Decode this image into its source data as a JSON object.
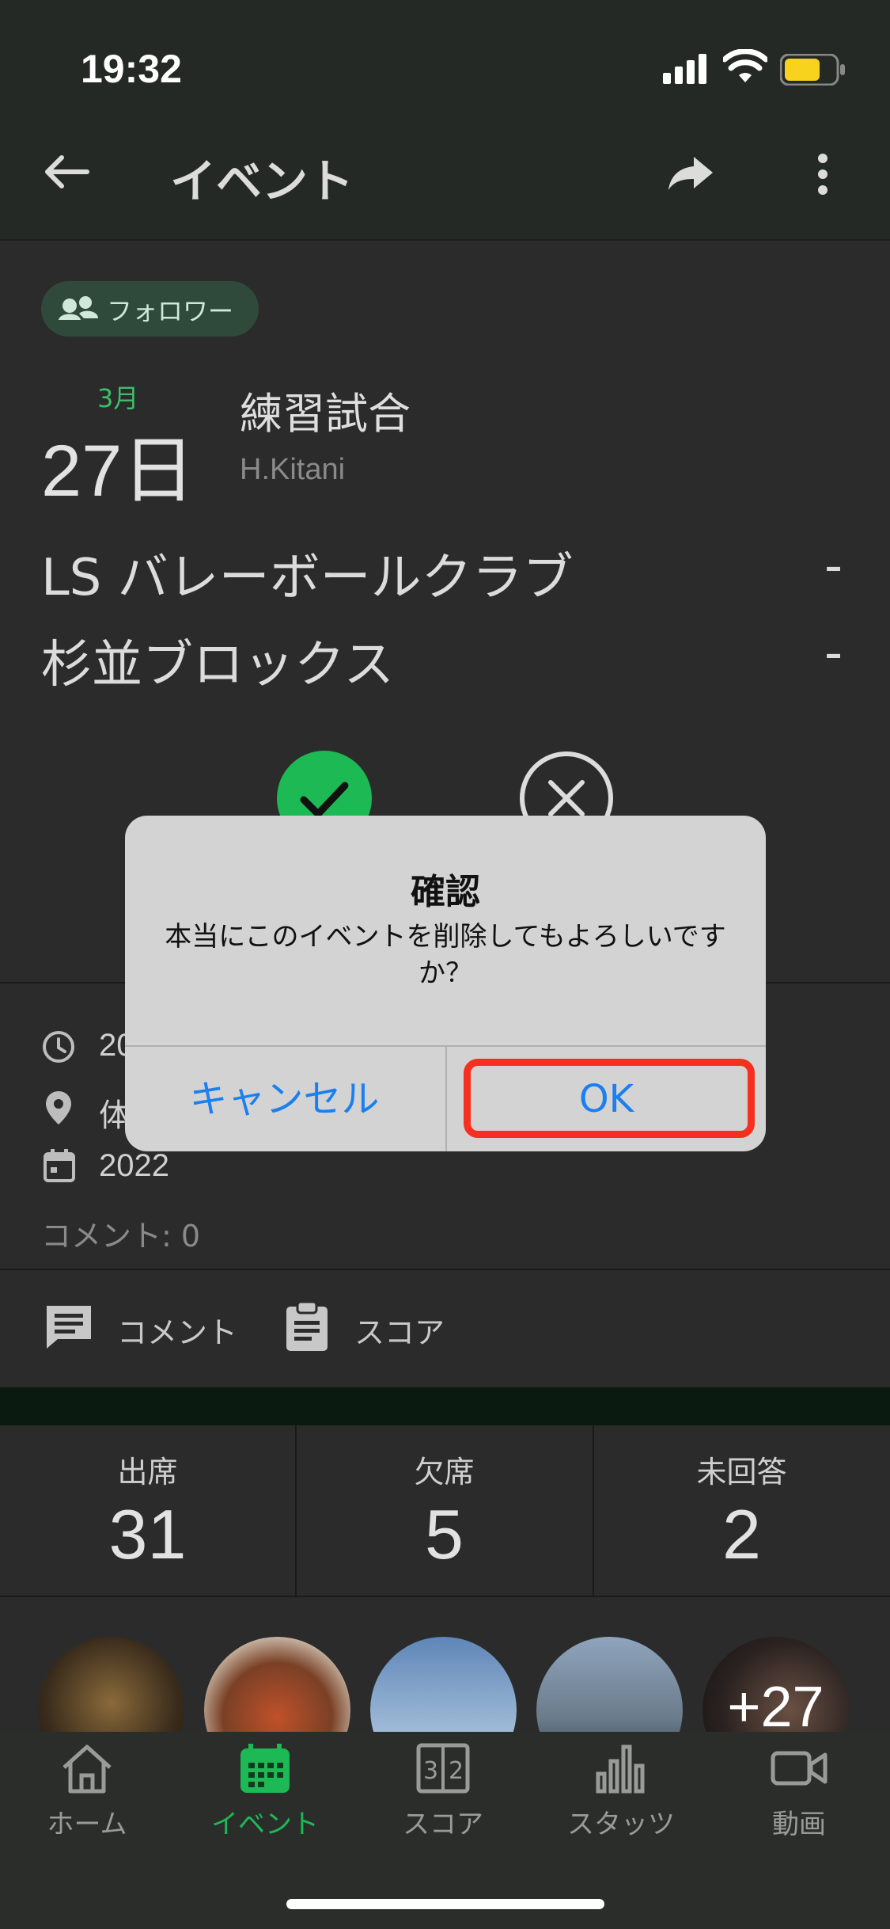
{
  "status_bar": {
    "time": "19:32"
  },
  "app_bar": {
    "title": "イベント",
    "back_icon": "back-arrow-icon",
    "share_icon": "share-icon",
    "more_icon": "more-vertical-icon"
  },
  "event": {
    "visibility_chip": "フォロワー",
    "month": "3月",
    "day": "27日",
    "name": "練習試合",
    "author": "H.Kitani",
    "teams": [
      {
        "name": "LS バレーボールクラブ",
        "score": "-"
      },
      {
        "name": "杉並ブロックス",
        "score": "-"
      }
    ]
  },
  "info": {
    "time_text": "20",
    "place_text": "体",
    "date_text": "2022",
    "comment_count": "コメント: 0"
  },
  "actions": {
    "comment_label": "コメント",
    "score_label": "スコア"
  },
  "attendance": [
    {
      "label": "出席",
      "value": "31"
    },
    {
      "label": "欠席",
      "value": "5"
    },
    {
      "label": "未回答",
      "value": "2"
    }
  ],
  "avatars": {
    "more_count": "+27"
  },
  "tabs": [
    {
      "label": "ホーム",
      "icon": "home-icon",
      "active": false
    },
    {
      "label": "イベント",
      "icon": "calendar-icon",
      "active": true
    },
    {
      "label": "スコア",
      "icon": "scoreboard-icon",
      "active": false
    },
    {
      "label": "スタッツ",
      "icon": "bar-chart-icon",
      "active": false
    },
    {
      "label": "動画",
      "icon": "video-icon",
      "active": false
    }
  ],
  "dialog": {
    "title": "確認",
    "message": "本当にこのイベントを削除してもよろしいですか？",
    "cancel_label": "キャンセル",
    "ok_label": "OK"
  },
  "colors": {
    "accent_green": "#1db954",
    "dialog_button": "#1a7ff0",
    "highlight": "#f53020"
  }
}
